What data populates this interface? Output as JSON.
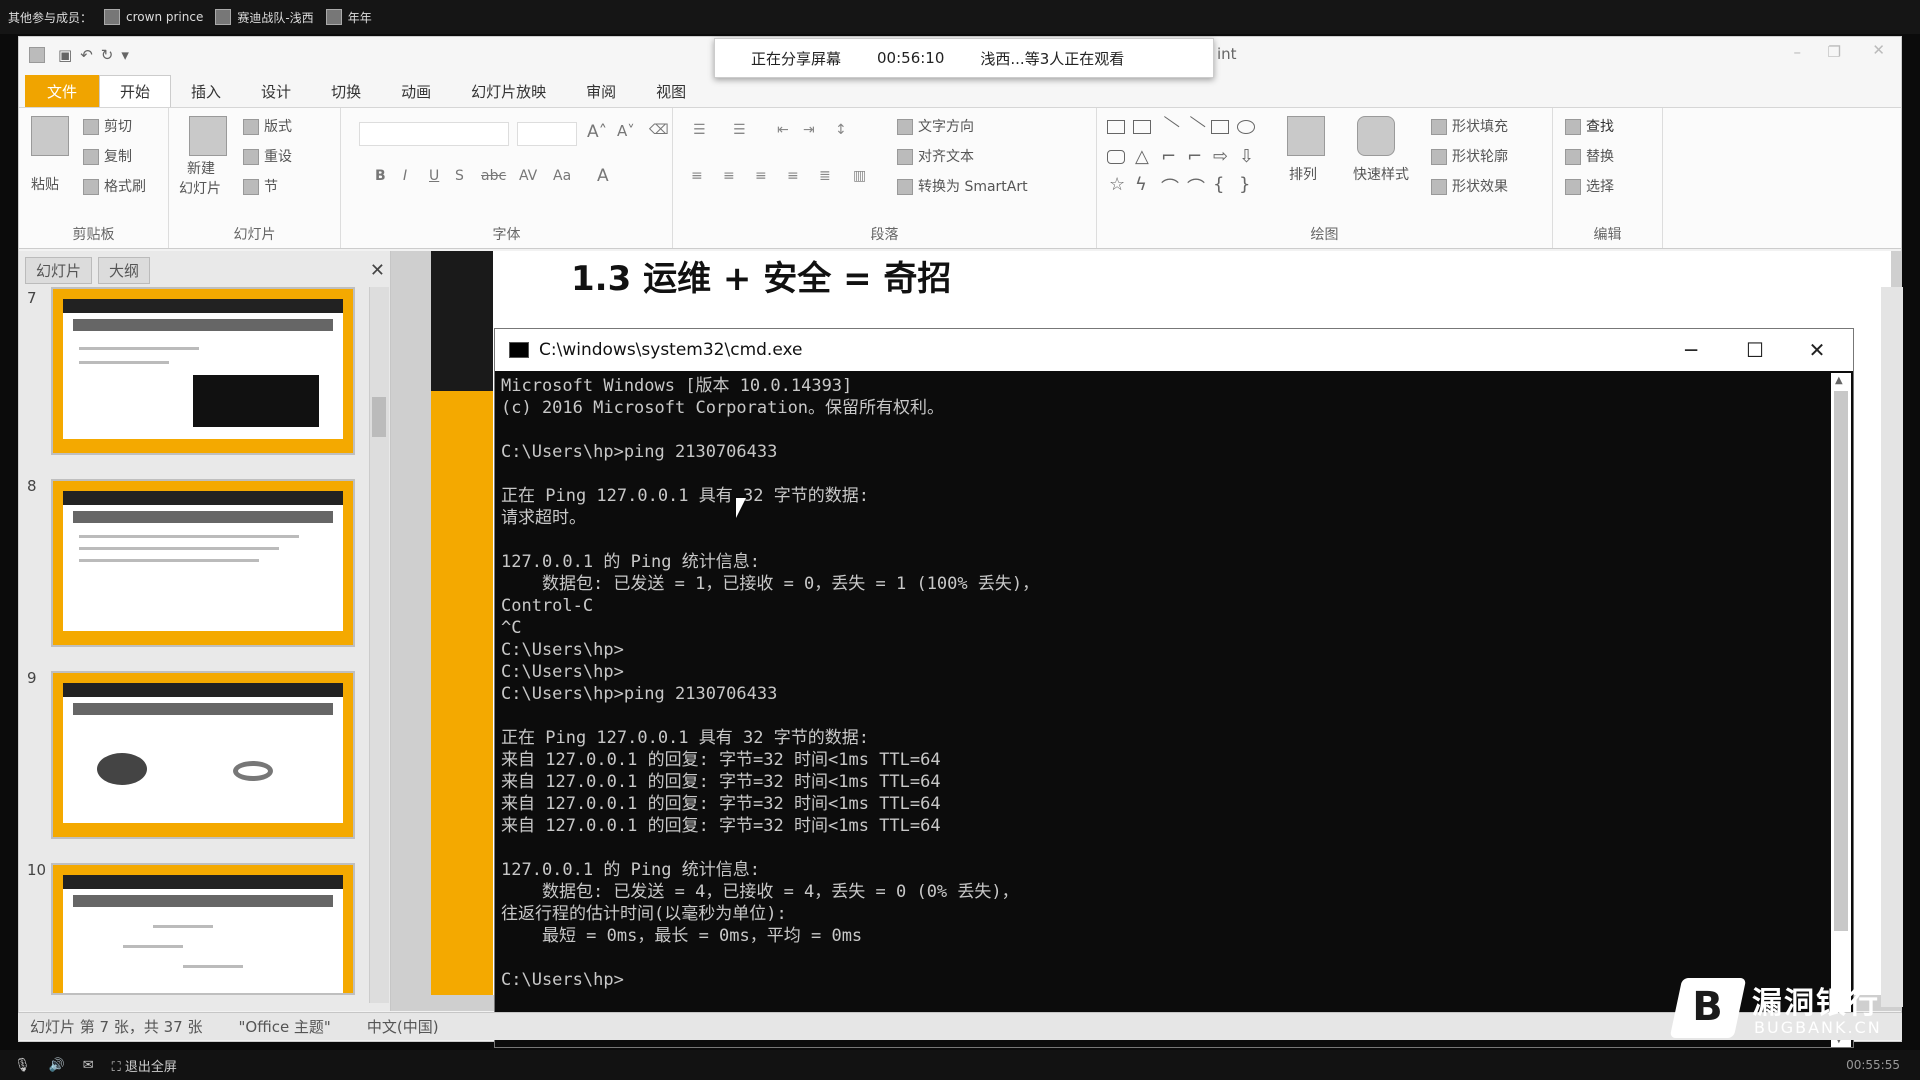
{
  "topbar": {
    "label": "其他参与成员：",
    "participants": [
      "crown prince",
      "赛迪战队-浅西",
      "年年"
    ]
  },
  "share_notice": {
    "status": "正在分享屏幕",
    "elapsed": "00:56:10",
    "viewers": "浅西...等3人正在观看"
  },
  "window": {
    "title_fragment": "int"
  },
  "ribbon": {
    "tabs": [
      "文件",
      "开始",
      "插入",
      "设计",
      "切换",
      "动画",
      "幻灯片放映",
      "审阅",
      "视图"
    ],
    "clipboard": {
      "paste": "粘贴",
      "cut": "剪切",
      "copy": "复制",
      "format_painter": "格式刷",
      "label": "剪贴板"
    },
    "slides": {
      "new_slide_1": "新建",
      "new_slide_2": "幻灯片",
      "layout": "版式",
      "reset": "重设",
      "section": "节",
      "label": "幻灯片"
    },
    "font": {
      "label": "字体"
    },
    "paragraph": {
      "text_direction": "文字方向",
      "align_text": "对齐文本",
      "smartart": "转换为 SmartArt",
      "label": "段落"
    },
    "drawing": {
      "arrange": "排列",
      "quick_styles": "快速样式",
      "shape_fill": "形状填充",
      "shape_outline": "形状轮廓",
      "shape_effects": "形状效果",
      "label": "绘图"
    },
    "editing": {
      "find": "查找",
      "replace": "替换",
      "select": "选择",
      "label": "编辑"
    }
  },
  "pane": {
    "tabs": [
      "幻灯片",
      "大纲"
    ],
    "slides": [
      {
        "number": "7"
      },
      {
        "number": "8"
      },
      {
        "number": "9"
      },
      {
        "number": "10"
      }
    ]
  },
  "slide": {
    "title": "1.3 运维 + 安全 = 奇招"
  },
  "cmd": {
    "title": "C:\\windows\\system32\\cmd.exe",
    "lines": [
      "Microsoft Windows [版本 10.0.14393]",
      "(c) 2016 Microsoft Corporation。保留所有权利。",
      "",
      "C:\\Users\\hp>ping 2130706433",
      "",
      "正在 Ping 127.0.0.1 具有 32 字节的数据:",
      "请求超时。",
      "",
      "127.0.0.1 的 Ping 统计信息:",
      "    数据包: 已发送 = 1，已接收 = 0，丢失 = 1 (100% 丢失)，",
      "Control-C",
      "^C",
      "C:\\Users\\hp>",
      "C:\\Users\\hp>",
      "C:\\Users\\hp>ping 2130706433",
      "",
      "正在 Ping 127.0.0.1 具有 32 字节的数据:",
      "来自 127.0.0.1 的回复: 字节=32 时间<1ms TTL=64",
      "来自 127.0.0.1 的回复: 字节=32 时间<1ms TTL=64",
      "来自 127.0.0.1 的回复: 字节=32 时间<1ms TTL=64",
      "来自 127.0.0.1 的回复: 字节=32 时间<1ms TTL=64",
      "",
      "127.0.0.1 的 Ping 统计信息:",
      "    数据包: 已发送 = 4，已接收 = 4，丢失 = 0 (0% 丢失)，",
      "往返行程的估计时间(以毫秒为单位):",
      "    最短 = 0ms，最长 = 0ms，平均 = 0ms",
      "",
      "C:\\Users\\hp>"
    ]
  },
  "status": {
    "slide_info": "幻灯片 第 7 张，共 37 张",
    "theme": "\"Office 主题\"",
    "language": "中文(中国)"
  },
  "sysbar": {
    "exit_fullscreen": "退出全屏",
    "clock": "00:55:55"
  },
  "watermark": {
    "cn": "漏洞银行",
    "en": "BUGBANK.CN"
  },
  "colors": {
    "accent": "#f4a900",
    "file_tab": "#f0a400",
    "cmd_bg": "#0c0c0c"
  }
}
